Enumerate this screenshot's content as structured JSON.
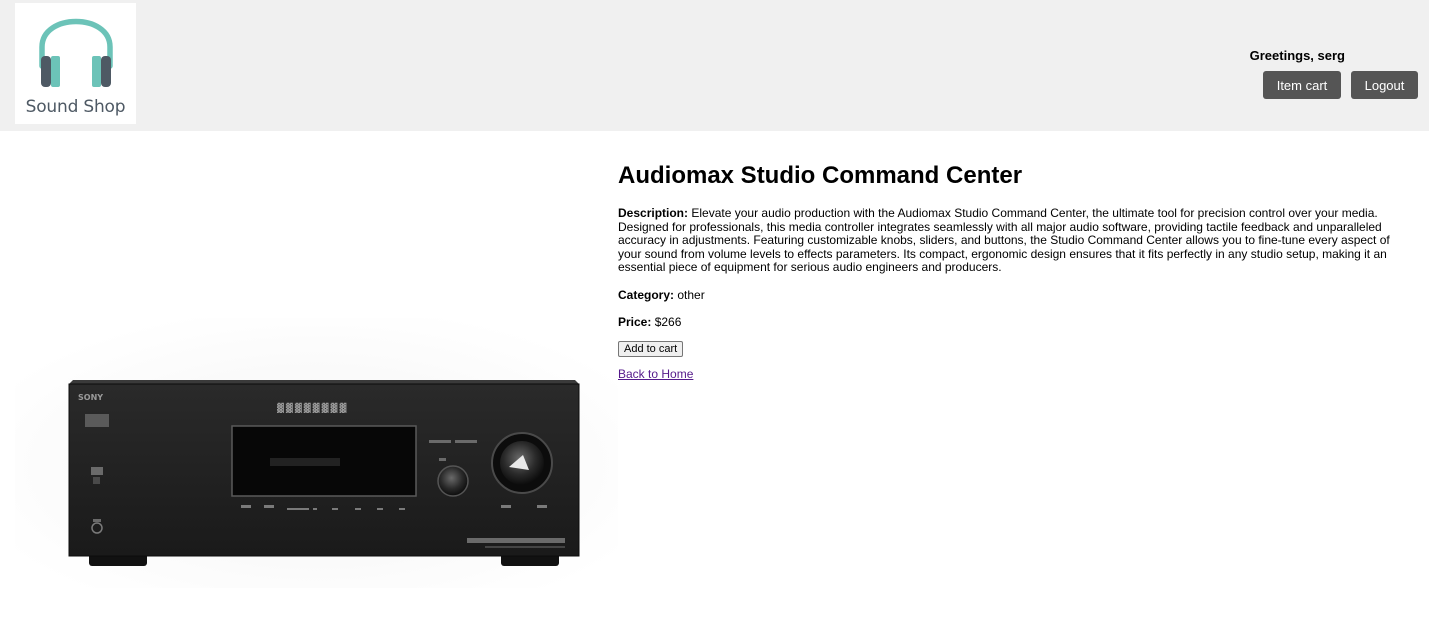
{
  "header": {
    "logo_text": "Sound Shop",
    "logo_icon": "headphones-icon",
    "greeting": "Greetings, serg",
    "cart_label": "Item cart",
    "logout_label": "Logout"
  },
  "product": {
    "title": "Audiomax Studio Command Center",
    "description_label": "Description:",
    "description": "Elevate your audio production with the Audiomax Studio Command Center, the ultimate tool for precision control over your media. Designed for professionals, this media controller integrates seamlessly with all major audio software, providing tactile feedback and unparalleled accuracy in adjustments. Featuring customizable knobs, sliders, and buttons, the Studio Command Center allows you to fine-tune every aspect of your sound from volume levels to effects parameters. Its compact, ergonomic design ensures that it fits perfectly in any studio setup, making it an essential piece of equipment for serious audio engineers and producers.",
    "category_label": "Category:",
    "category": "other",
    "price_label": "Price:",
    "price": "$266",
    "add_to_cart_label": "Add to cart",
    "back_label": "Back to Home",
    "image_brand_text": "SONY"
  },
  "colors": {
    "header_bg": "#f0f0f0",
    "button_bg": "#555555",
    "logo_accent": "#6cc3b8",
    "logo_dark": "#4e5964",
    "link_visited": "#551a8b"
  }
}
